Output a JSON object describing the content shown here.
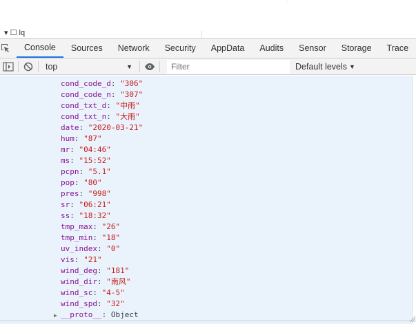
{
  "window": {
    "tiny_mark": "˙",
    "fragment": "▾ ☐ lq"
  },
  "tabs": [
    {
      "label": "Console",
      "active": true
    },
    {
      "label": "Sources",
      "active": false
    },
    {
      "label": "Network",
      "active": false
    },
    {
      "label": "Security",
      "active": false
    },
    {
      "label": "AppData",
      "active": false
    },
    {
      "label": "Audits",
      "active": false
    },
    {
      "label": "Sensor",
      "active": false
    },
    {
      "label": "Storage",
      "active": false
    },
    {
      "label": "Trace",
      "active": false
    }
  ],
  "toolbar": {
    "context_value": "top",
    "filter_placeholder": "Filter",
    "levels_label": "Default levels",
    "icons": [
      "inspect-element-icon",
      "sidebar-toggle-icon",
      "clear-console-icon",
      "eye-icon"
    ]
  },
  "console": {
    "entries": [
      {
        "key": "cond_code_d",
        "value": "\"306\""
      },
      {
        "key": "cond_code_n",
        "value": "\"307\""
      },
      {
        "key": "cond_txt_d",
        "value": "\"中雨\""
      },
      {
        "key": "cond_txt_n",
        "value": "\"大雨\""
      },
      {
        "key": "date",
        "value": "\"2020-03-21\""
      },
      {
        "key": "hum",
        "value": "\"87\""
      },
      {
        "key": "mr",
        "value": "\"04:46\""
      },
      {
        "key": "ms",
        "value": "\"15:52\""
      },
      {
        "key": "pcpn",
        "value": "\"5.1\""
      },
      {
        "key": "pop",
        "value": "\"80\""
      },
      {
        "key": "pres",
        "value": "\"998\""
      },
      {
        "key": "sr",
        "value": "\"06:21\""
      },
      {
        "key": "ss",
        "value": "\"18:32\""
      },
      {
        "key": "tmp_max",
        "value": "\"26\""
      },
      {
        "key": "tmp_min",
        "value": "\"18\""
      },
      {
        "key": "uv_index",
        "value": "\"0\""
      },
      {
        "key": "vis",
        "value": "\"21\""
      },
      {
        "key": "wind_deg",
        "value": "\"181\""
      },
      {
        "key": "wind_dir",
        "value": "\"南风\""
      },
      {
        "key": "wind_sc",
        "value": "\"4-5\""
      },
      {
        "key": "wind_spd",
        "value": "\"32\""
      }
    ],
    "proto": {
      "key": "__proto__",
      "value": "Object"
    }
  },
  "colors": {
    "console_bg": "#eaf3fc",
    "key": "#881391",
    "string_value": "#c41a16",
    "active_tab_underline": "#1a73e8"
  }
}
